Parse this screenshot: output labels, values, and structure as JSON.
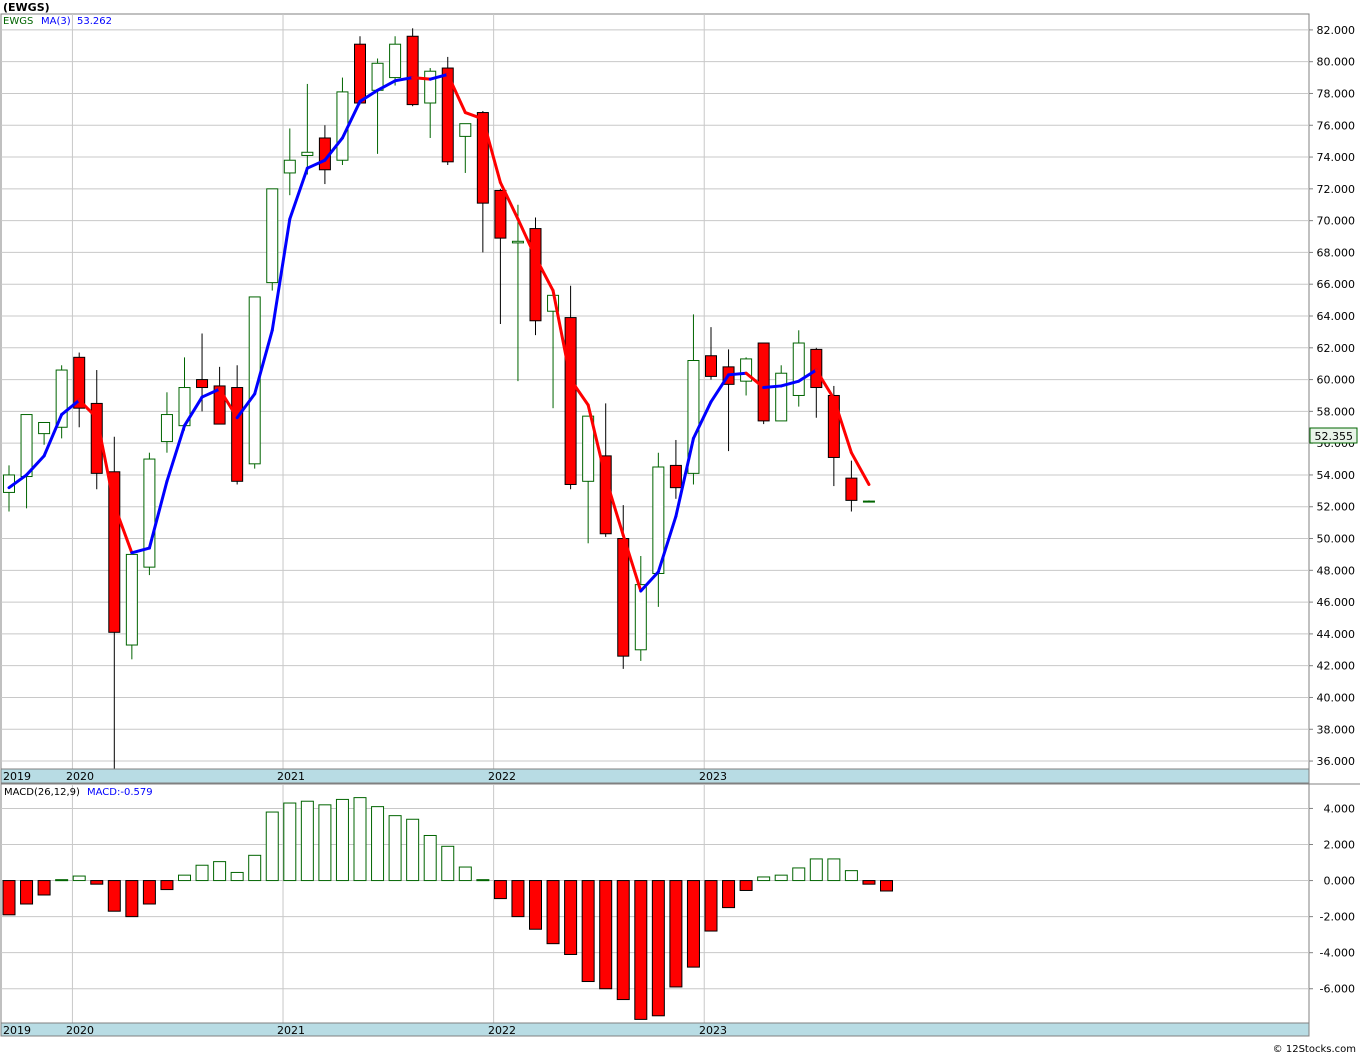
{
  "title": "(EWGS)",
  "price_legend": {
    "symbol": "EWGS",
    "ma_label": "MA(3)",
    "ma_value": "53.262"
  },
  "price_badge": "52.355",
  "macd_legend": {
    "label": "MACD(26,12,9)",
    "value_label": "MACD:-0.579"
  },
  "x_axis_labels": [
    "2019",
    "2020",
    "2021",
    "2022",
    "2023"
  ],
  "watermark": "© 12Stocks.com",
  "colors": {
    "up_candle": "#006400",
    "down_candle": "#ff0000",
    "ma_up": "#0000ff",
    "ma_down": "#ff0000",
    "axis_band": "#b8dce4",
    "grid": "#c8c8c8"
  },
  "chart_data": [
    {
      "type": "candlestick",
      "interval": "monthly",
      "y_ticks": [
        36,
        38,
        40,
        42,
        44,
        46,
        48,
        50,
        52,
        54,
        56,
        58,
        60,
        62,
        64,
        66,
        68,
        70,
        72,
        74,
        76,
        78,
        80,
        82
      ],
      "ylim": [
        35.5,
        83.0
      ],
      "last_price": 52.355,
      "candles": [
        {
          "o": 52.9,
          "h": 54.6,
          "l": 51.7,
          "c": 54.0
        },
        {
          "o": 53.9,
          "h": 57.6,
          "l": 51.9,
          "c": 57.8
        },
        {
          "o": 56.6,
          "h": 57.2,
          "l": 55.9,
          "c": 57.3
        },
        {
          "o": 57.0,
          "h": 60.9,
          "l": 56.3,
          "c": 60.6
        },
        {
          "o": 61.4,
          "h": 61.7,
          "l": 57.0,
          "c": 58.2
        },
        {
          "o": 58.5,
          "h": 60.6,
          "l": 53.1,
          "c": 54.1
        },
        {
          "o": 54.2,
          "h": 56.4,
          "l": 35.5,
          "c": 44.1
        },
        {
          "o": 43.3,
          "h": 49.0,
          "l": 42.4,
          "c": 49.0
        },
        {
          "o": 48.2,
          "h": 55.4,
          "l": 47.7,
          "c": 55.0
        },
        {
          "o": 56.1,
          "h": 59.2,
          "l": 55.4,
          "c": 57.8
        },
        {
          "o": 57.1,
          "h": 61.4,
          "l": 56.8,
          "c": 59.5
        },
        {
          "o": 60.0,
          "h": 62.9,
          "l": 58.0,
          "c": 59.5
        },
        {
          "o": 59.6,
          "h": 60.8,
          "l": 57.5,
          "c": 57.2
        },
        {
          "o": 59.5,
          "h": 60.9,
          "l": 53.4,
          "c": 53.6
        },
        {
          "o": 54.7,
          "h": 63.1,
          "l": 54.4,
          "c": 65.2
        },
        {
          "o": 66.1,
          "h": 71.9,
          "l": 65.6,
          "c": 72.0
        },
        {
          "o": 73.0,
          "h": 75.8,
          "l": 71.6,
          "c": 73.8
        },
        {
          "o": 74.1,
          "h": 78.6,
          "l": 72.9,
          "c": 74.3
        },
        {
          "o": 75.2,
          "h": 76.0,
          "l": 72.3,
          "c": 73.2
        },
        {
          "o": 73.8,
          "h": 79.0,
          "l": 73.5,
          "c": 78.1
        },
        {
          "o": 81.1,
          "h": 81.6,
          "l": 77.3,
          "c": 77.4
        },
        {
          "o": 78.2,
          "h": 80.2,
          "l": 74.2,
          "c": 79.9
        },
        {
          "o": 79.0,
          "h": 81.6,
          "l": 78.5,
          "c": 81.1
        },
        {
          "o": 81.6,
          "h": 82.1,
          "l": 77.2,
          "c": 77.3
        },
        {
          "o": 77.4,
          "h": 79.6,
          "l": 75.2,
          "c": 79.4
        },
        {
          "o": 79.6,
          "h": 80.3,
          "l": 73.5,
          "c": 73.7
        },
        {
          "o": 75.3,
          "h": 76.1,
          "l": 73.0,
          "c": 76.1
        },
        {
          "o": 76.8,
          "h": 76.9,
          "l": 68.0,
          "c": 71.1
        },
        {
          "o": 71.9,
          "h": 72.0,
          "l": 63.5,
          "c": 68.9
        },
        {
          "o": 68.6,
          "h": 71.0,
          "l": 59.9,
          "c": 68.7
        },
        {
          "o": 69.5,
          "h": 70.2,
          "l": 62.8,
          "c": 63.7
        },
        {
          "o": 64.3,
          "h": 65.6,
          "l": 58.2,
          "c": 65.3
        },
        {
          "o": 63.9,
          "h": 65.9,
          "l": 53.1,
          "c": 53.4
        },
        {
          "o": 53.6,
          "h": 57.7,
          "l": 49.7,
          "c": 57.7
        },
        {
          "o": 55.2,
          "h": 58.5,
          "l": 50.1,
          "c": 50.3
        },
        {
          "o": 50.0,
          "h": 52.1,
          "l": 41.8,
          "c": 42.6
        },
        {
          "o": 43.0,
          "h": 48.9,
          "l": 42.3,
          "c": 47.1
        },
        {
          "o": 47.8,
          "h": 55.4,
          "l": 45.7,
          "c": 54.5
        },
        {
          "o": 54.6,
          "h": 56.2,
          "l": 52.5,
          "c": 53.2
        },
        {
          "o": 54.1,
          "h": 64.1,
          "l": 53.4,
          "c": 61.2
        },
        {
          "o": 61.5,
          "h": 63.3,
          "l": 60.0,
          "c": 60.2
        },
        {
          "o": 60.8,
          "h": 61.9,
          "l": 55.5,
          "c": 59.7
        },
        {
          "o": 59.9,
          "h": 61.4,
          "l": 59.0,
          "c": 61.3
        },
        {
          "o": 62.3,
          "h": 62.3,
          "l": 57.2,
          "c": 57.4
        },
        {
          "o": 57.4,
          "h": 60.9,
          "l": 57.4,
          "c": 60.4
        },
        {
          "o": 59.0,
          "h": 63.1,
          "l": 58.3,
          "c": 62.3
        },
        {
          "o": 61.9,
          "h": 62.0,
          "l": 57.6,
          "c": 59.5
        },
        {
          "o": 59.0,
          "h": 59.6,
          "l": 53.3,
          "c": 55.1
        },
        {
          "o": 53.8,
          "h": 54.9,
          "l": 51.7,
          "c": 52.4
        },
        {
          "o": 52.35,
          "h": 52.4,
          "l": 52.3,
          "c": 52.355
        }
      ],
      "ma3": [
        53.2,
        54.0,
        55.2,
        57.8,
        58.7,
        57.6,
        52.1,
        49.1,
        49.4,
        53.6,
        57.1,
        58.9,
        59.4,
        57.6,
        59.1,
        63.1,
        70.1,
        73.3,
        73.8,
        75.2,
        77.5,
        78.2,
        78.8,
        79.0,
        78.9,
        79.2,
        76.8,
        76.4,
        72.4,
        70.1,
        67.7,
        65.6,
        60.0,
        58.4,
        53.8,
        50.2,
        46.7,
        47.9,
        51.4,
        56.3,
        58.6,
        60.3,
        60.4,
        59.5,
        59.6,
        59.9,
        60.6,
        58.8,
        55.4,
        53.4
      ]
    },
    {
      "type": "bar",
      "name": "MACD(26,12,9)",
      "y_ticks": [
        -6,
        -4,
        -2,
        0,
        2,
        4
      ],
      "ylim": [
        -7.9,
        5.3
      ],
      "values": [
        -1.9,
        -1.3,
        -0.8,
        0.05,
        0.25,
        -0.2,
        -1.7,
        -2.0,
        -1.3,
        -0.5,
        0.3,
        0.85,
        1.05,
        0.45,
        1.4,
        3.8,
        4.3,
        4.4,
        4.2,
        4.5,
        4.6,
        4.1,
        3.6,
        3.4,
        2.5,
        1.9,
        0.75,
        0.05,
        -1.0,
        -2.0,
        -2.7,
        -3.5,
        -4.1,
        -5.6,
        -6.0,
        -6.6,
        -7.7,
        -7.5,
        -5.9,
        -4.8,
        -2.8,
        -1.5,
        -0.55,
        0.2,
        0.3,
        0.7,
        1.2,
        1.2,
        0.55,
        -0.2,
        -0.579
      ]
    }
  ]
}
